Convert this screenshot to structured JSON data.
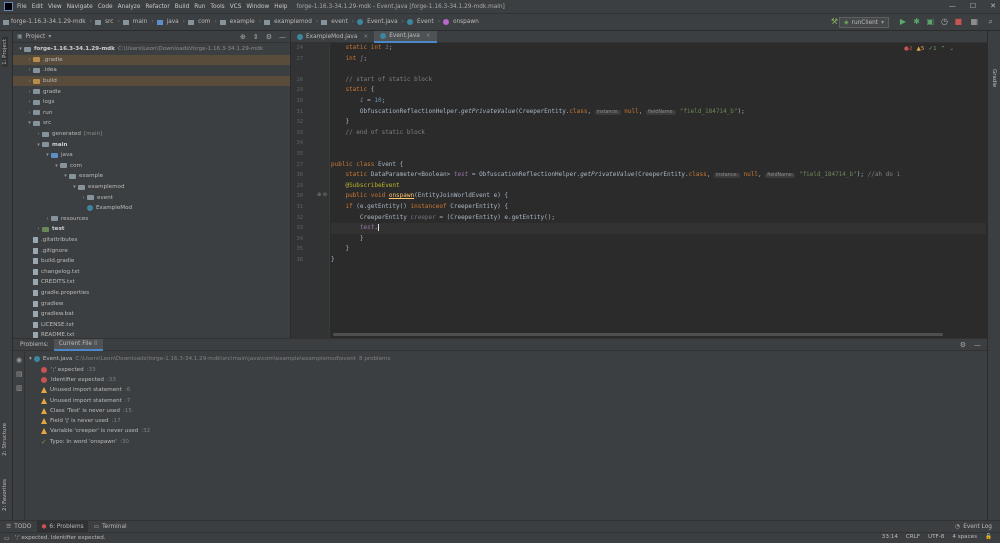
{
  "window": {
    "menu": [
      "File",
      "Edit",
      "View",
      "Navigate",
      "Code",
      "Analyze",
      "Refactor",
      "Build",
      "Run",
      "Tools",
      "VCS",
      "Window",
      "Help"
    ],
    "title": "forge-1.16.3-34.1.29-mdk - Event.java [forge-1.16.3-34.1.29-mdk.main]"
  },
  "breadcrumb": [
    "forge-1.16.3-34.1.29-mdk",
    "src",
    "main",
    "java",
    "com",
    "example",
    "examplemod",
    "event",
    "Event.java",
    "Event",
    "onspawn"
  ],
  "run_config": "runClient",
  "project": {
    "header": "Project",
    "tree": [
      {
        "label": "forge-1.16.3-34.1.29-mdk",
        "extra": "C:\\Users\\Leon\\Downloads\\forge-1.16.3-34.1.29-mdk",
        "depth": 0,
        "kind": "folder",
        "open": true,
        "bold": true
      },
      {
        "label": ".gradle",
        "depth": 1,
        "kind": "folder-orange",
        "open": false,
        "hl": true
      },
      {
        "label": ".idea",
        "depth": 1,
        "kind": "folder",
        "open": false
      },
      {
        "label": "build",
        "depth": 1,
        "kind": "folder-orange",
        "open": false,
        "hl": true
      },
      {
        "label": "gradle",
        "depth": 1,
        "kind": "folder",
        "open": false
      },
      {
        "label": "logs",
        "depth": 1,
        "kind": "folder",
        "open": false
      },
      {
        "label": "run",
        "depth": 1,
        "kind": "folder",
        "open": false
      },
      {
        "label": "src",
        "depth": 1,
        "kind": "folder",
        "open": true
      },
      {
        "label": "generated",
        "extra": "[main]",
        "depth": 2,
        "kind": "folder",
        "open": false
      },
      {
        "label": "main",
        "depth": 2,
        "kind": "folder",
        "open": true,
        "bold": true
      },
      {
        "label": "java",
        "depth": 3,
        "kind": "folder-blue",
        "open": true
      },
      {
        "label": "com",
        "depth": 4,
        "kind": "folder",
        "open": true
      },
      {
        "label": "example",
        "depth": 5,
        "kind": "folder",
        "open": true
      },
      {
        "label": "examplemod",
        "depth": 6,
        "kind": "folder",
        "open": true
      },
      {
        "label": "event",
        "depth": 7,
        "kind": "folder",
        "open": false
      },
      {
        "label": "ExampleMod",
        "depth": 7,
        "kind": "class"
      },
      {
        "label": "resources",
        "depth": 3,
        "kind": "folder",
        "open": false
      },
      {
        "label": "test",
        "depth": 2,
        "kind": "folder-green",
        "open": false,
        "bold": true
      },
      {
        "label": ".gitattributes",
        "depth": 1,
        "kind": "file"
      },
      {
        "label": ".gitignore",
        "depth": 1,
        "kind": "file"
      },
      {
        "label": "build.gradle",
        "depth": 1,
        "kind": "file"
      },
      {
        "label": "changelog.txt",
        "depth": 1,
        "kind": "file"
      },
      {
        "label": "CREDITS.txt",
        "depth": 1,
        "kind": "file"
      },
      {
        "label": "gradle.properties",
        "depth": 1,
        "kind": "file"
      },
      {
        "label": "gradlew",
        "depth": 1,
        "kind": "file"
      },
      {
        "label": "gradlew.bat",
        "depth": 1,
        "kind": "file"
      },
      {
        "label": "LICENSE.txt",
        "depth": 1,
        "kind": "file"
      },
      {
        "label": "README.txt",
        "depth": 1,
        "kind": "file"
      }
    ]
  },
  "editor": {
    "tabs": [
      {
        "label": "ExampleMod.java",
        "active": false
      },
      {
        "label": "Event.java",
        "active": true
      }
    ],
    "inspections": {
      "errors": "2",
      "warnings": "5",
      "ok": "1"
    },
    "line_numbers": [
      "24",
      "27",
      "",
      "26",
      "29",
      "30",
      "31",
      "32",
      "33",
      "34",
      "35",
      "27",
      "36",
      "29",
      "30",
      "31",
      "32",
      "33",
      "34",
      "35",
      "36"
    ],
    "hints": {
      "instance": "instance:",
      "fieldName": "fieldName:"
    }
  },
  "problems": {
    "tabs": [
      "Problems:",
      "Current File",
      "8"
    ],
    "file": "Event.java",
    "file_path": "C:\\Users\\Leon\\Downloads\\forge-1.16.3-34.1.29-mdk\\src\\main\\java\\com\\example\\examplemod\\event",
    "file_count": "8 problems",
    "items": [
      {
        "level": "error",
        "text": "';' expected",
        "loc": ":33"
      },
      {
        "level": "error",
        "text": "Identifier expected",
        "loc": ":33"
      },
      {
        "level": "warn",
        "text": "Unused import statement",
        "loc": ":6"
      },
      {
        "level": "warn",
        "text": "Unused import statement",
        "loc": ":7"
      },
      {
        "level": "warn",
        "text": "Class 'Test' is never used",
        "loc": ":15"
      },
      {
        "level": "warn",
        "text": "Field 'j' is never used",
        "loc": ":17"
      },
      {
        "level": "warn",
        "text": "Variable 'creeper' is never used",
        "loc": ":32"
      },
      {
        "level": "ok",
        "text": "Typo: In word 'onspawn'",
        "loc": ":30"
      }
    ]
  },
  "bottom_tools": [
    "TODO",
    "6: Problems",
    "Terminal"
  ],
  "side_tools": {
    "project": "1: Project",
    "structure": "2: Structure",
    "favorites": "2: Favorites",
    "gradle": "Gradle"
  },
  "status": {
    "message": "';' expected. Identifier expected.",
    "event_log": "Event Log",
    "position": "33:14",
    "line_sep": "CRLF",
    "encoding": "UTF-8",
    "indent": "4 spaces"
  },
  "colors": {
    "accent": "#4a88c7",
    "error": "#c75450",
    "warning": "#e3a740",
    "keyword": "#cc7832",
    "string": "#6a8759",
    "comment": "#808080"
  }
}
